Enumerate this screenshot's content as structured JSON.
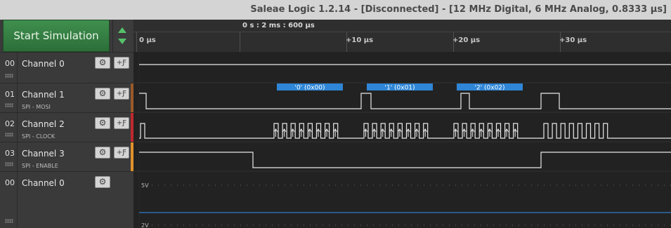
{
  "window": {
    "title": "Saleae Logic 1.2.14 - [Disconnected] - [12 MHz Digital, 6 MHz Analog, 0.8333 µs]"
  },
  "toolbar": {
    "start_label": "Start Simulation"
  },
  "timeline": {
    "position": "0 s : 2 ms : 600 µs",
    "ticks": [
      "0 µs",
      "+10 µs",
      "+20 µs",
      "+30 µs"
    ]
  },
  "channels": [
    {
      "num": "00",
      "name": "Channel 0",
      "sub": "",
      "color": ""
    },
    {
      "num": "01",
      "name": "Channel 1",
      "sub": "SPI - MOSI",
      "color": "#9a5a2a"
    },
    {
      "num": "02",
      "name": "Channel 2",
      "sub": "SPI - CLOCK",
      "color": "#c0282e"
    },
    {
      "num": "03",
      "name": "Channel 3",
      "sub": "SPI - ENABLE",
      "color": "#e0922a"
    },
    {
      "num": "00",
      "name": "Channel 0",
      "sub": "",
      "color": ""
    }
  ],
  "decoded": [
    "'0' (0x00)",
    "'1' (0x01)",
    "'2' (0x02)"
  ],
  "analog": {
    "top_label": "5V",
    "bottom_label": "2V"
  },
  "colors": {
    "wave": "#e8e8e8",
    "decode": "#2f86d6",
    "analog_line": "#2f7ec8",
    "start_button": "#3f8f4e"
  },
  "icons": [
    "gear-icon",
    "trigger-icon",
    "arrow-up-icon",
    "arrow-down-icon",
    "grip-icon"
  ]
}
